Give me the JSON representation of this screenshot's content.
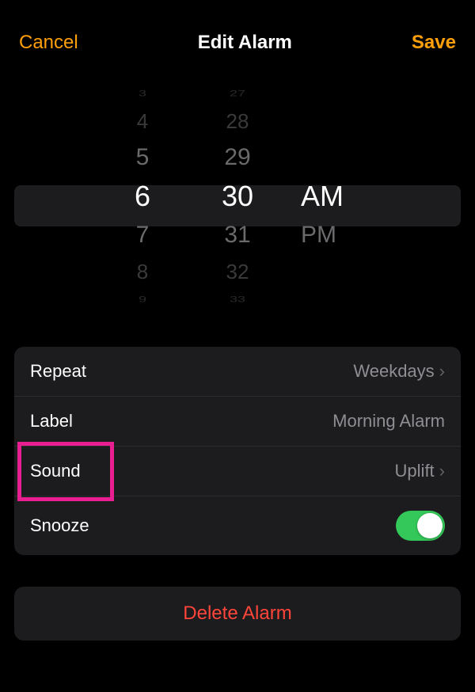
{
  "header": {
    "cancel": "Cancel",
    "title": "Edit Alarm",
    "save": "Save"
  },
  "picker": {
    "hours": [
      "3",
      "4",
      "5",
      "6",
      "7",
      "8",
      "9"
    ],
    "minutes": [
      "27",
      "28",
      "29",
      "30",
      "31",
      "32",
      "33"
    ],
    "ampm": [
      "AM",
      "PM"
    ]
  },
  "settings": {
    "repeat": {
      "label": "Repeat",
      "value": "Weekdays"
    },
    "label": {
      "label": "Label",
      "value": "Morning Alarm"
    },
    "sound": {
      "label": "Sound",
      "value": "Uplift"
    },
    "snooze": {
      "label": "Snooze",
      "enabled": true
    }
  },
  "delete": {
    "label": "Delete Alarm"
  },
  "highlight": {
    "target": "sound",
    "color": "#e91e90"
  }
}
